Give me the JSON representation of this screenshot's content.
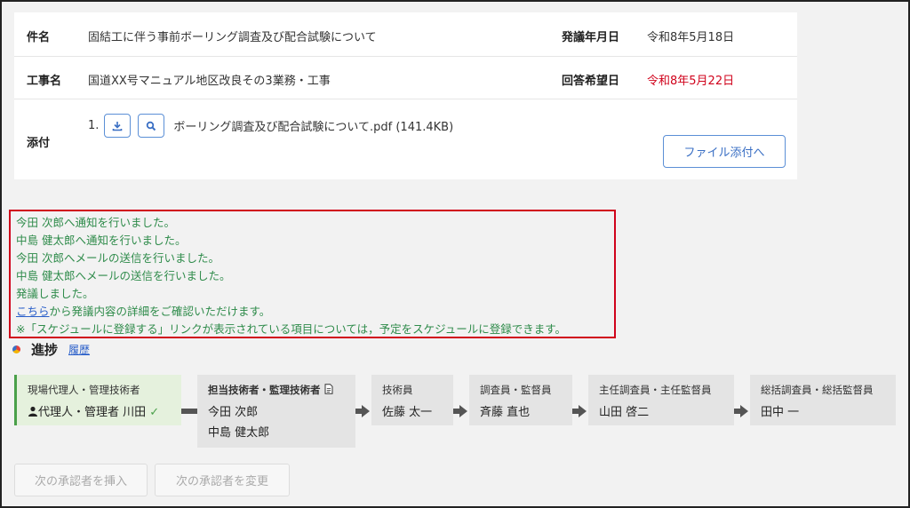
{
  "info": {
    "subject_label": "件名",
    "subject_value": "固結工に伴う事前ボーリング調査及び配合試験について",
    "issue_date_label": "発議年月日",
    "issue_date_value": "令和8年5月18日",
    "work_name_label": "工事名",
    "work_name_value": "国道XX号マニュアル地区改良その3業務・工事",
    "reply_date_label": "回答希望日",
    "reply_date_value": "令和8年5月22日",
    "attach_label": "添付",
    "attachment": {
      "number": "1.",
      "download_icon": "download-icon",
      "preview_icon": "magnifier-icon",
      "filename": "ボーリング調査及び配合試験について.pdf (141.4KB)"
    },
    "attach_button": "ファイル添付へ"
  },
  "notifications": {
    "lines": [
      "今田 次郎へ通知を行いました。",
      "中島 健太郎へ通知を行いました。",
      "今田 次郎へメールの送信を行いました。",
      "中島 健太郎へメールの送信を行いました。",
      "発議しました。"
    ],
    "link_text": "こちら",
    "link_suffix": "から発議内容の詳細をご確認いただけます。",
    "note": "※「スケジュールに登録する」リンクが表示されている項目については，予定をスケジュールに登録できます。"
  },
  "progress": {
    "title": "進捗",
    "history_link": "履歴",
    "steps": [
      {
        "role": "現場代理人・管理技術者",
        "person": "代理人・管理者 川田",
        "icon": "person-icon",
        "status": "check-icon"
      },
      {
        "role": "担当技術者・監理技術者",
        "role_icon": "document-icon",
        "persons": [
          "今田 次郎",
          "中島 健太郎"
        ]
      },
      {
        "role": "技術員",
        "person": "佐藤 太一"
      },
      {
        "role": "調査員・監督員",
        "person": "斉藤 直也"
      },
      {
        "role": "主任調査員・主任監督員",
        "person": "山田 啓二"
      },
      {
        "role": "総括調査員・総括監督員",
        "person": "田中 一"
      }
    ]
  },
  "buttons": {
    "insert_next": "次の承認者を挿入",
    "change_next": "次の承認者を変更"
  },
  "colors": {
    "notify_text": "#2e8b4a",
    "notify_border": "#d0021b",
    "reply_date": "#d0021b",
    "link": "#2a5fc9",
    "current_step_bg": "#e5f1dd"
  }
}
